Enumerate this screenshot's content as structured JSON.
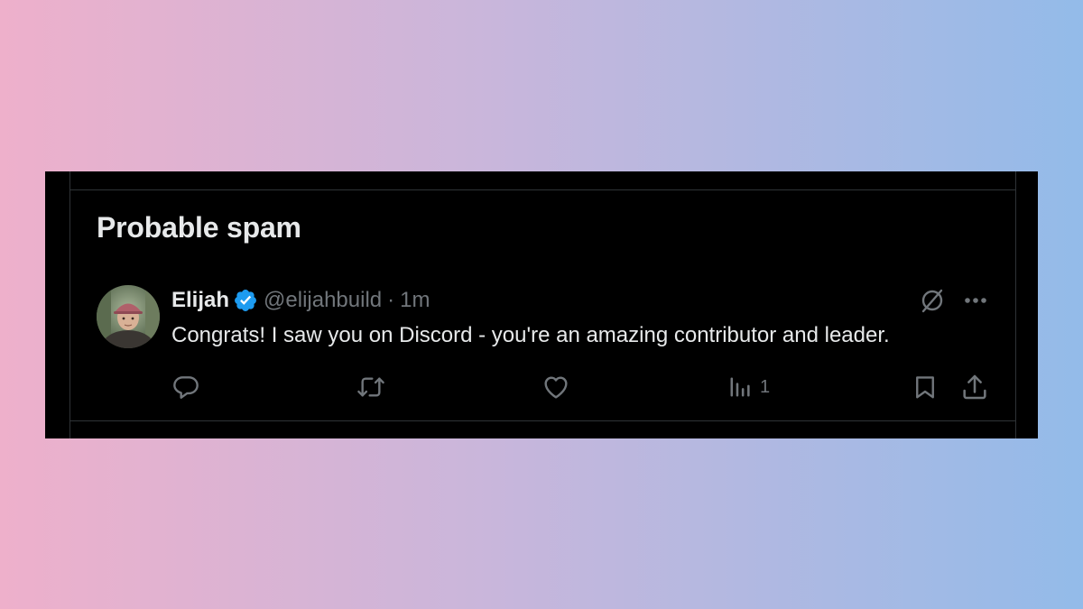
{
  "section": {
    "title": "Probable spam"
  },
  "tweet": {
    "display_name": "Elijah",
    "handle": "@elijahbuild",
    "separator": "·",
    "time": "1m",
    "text": "Congrats! I saw you on Discord - you're an amazing contributor and leader.",
    "verified": true,
    "avatar": "profile-photo"
  },
  "actions": {
    "reply_icon": "reply-icon",
    "retweet_icon": "retweet-icon",
    "like_icon": "heart-icon",
    "views_icon": "views-icon",
    "views_count": "1",
    "bookmark_icon": "bookmark-icon",
    "share_icon": "share-icon"
  },
  "header_actions": {
    "grok_icon": "grok-icon",
    "more_icon": "more-icon"
  },
  "colors": {
    "background_gradient_start": "#eeb0cb",
    "background_gradient_end": "#93bbe9",
    "card_background": "#000000",
    "primary_text": "#e7e9ea",
    "secondary_text": "#71767b",
    "border": "#2f3336",
    "verified_badge": "#1d9bf0"
  }
}
